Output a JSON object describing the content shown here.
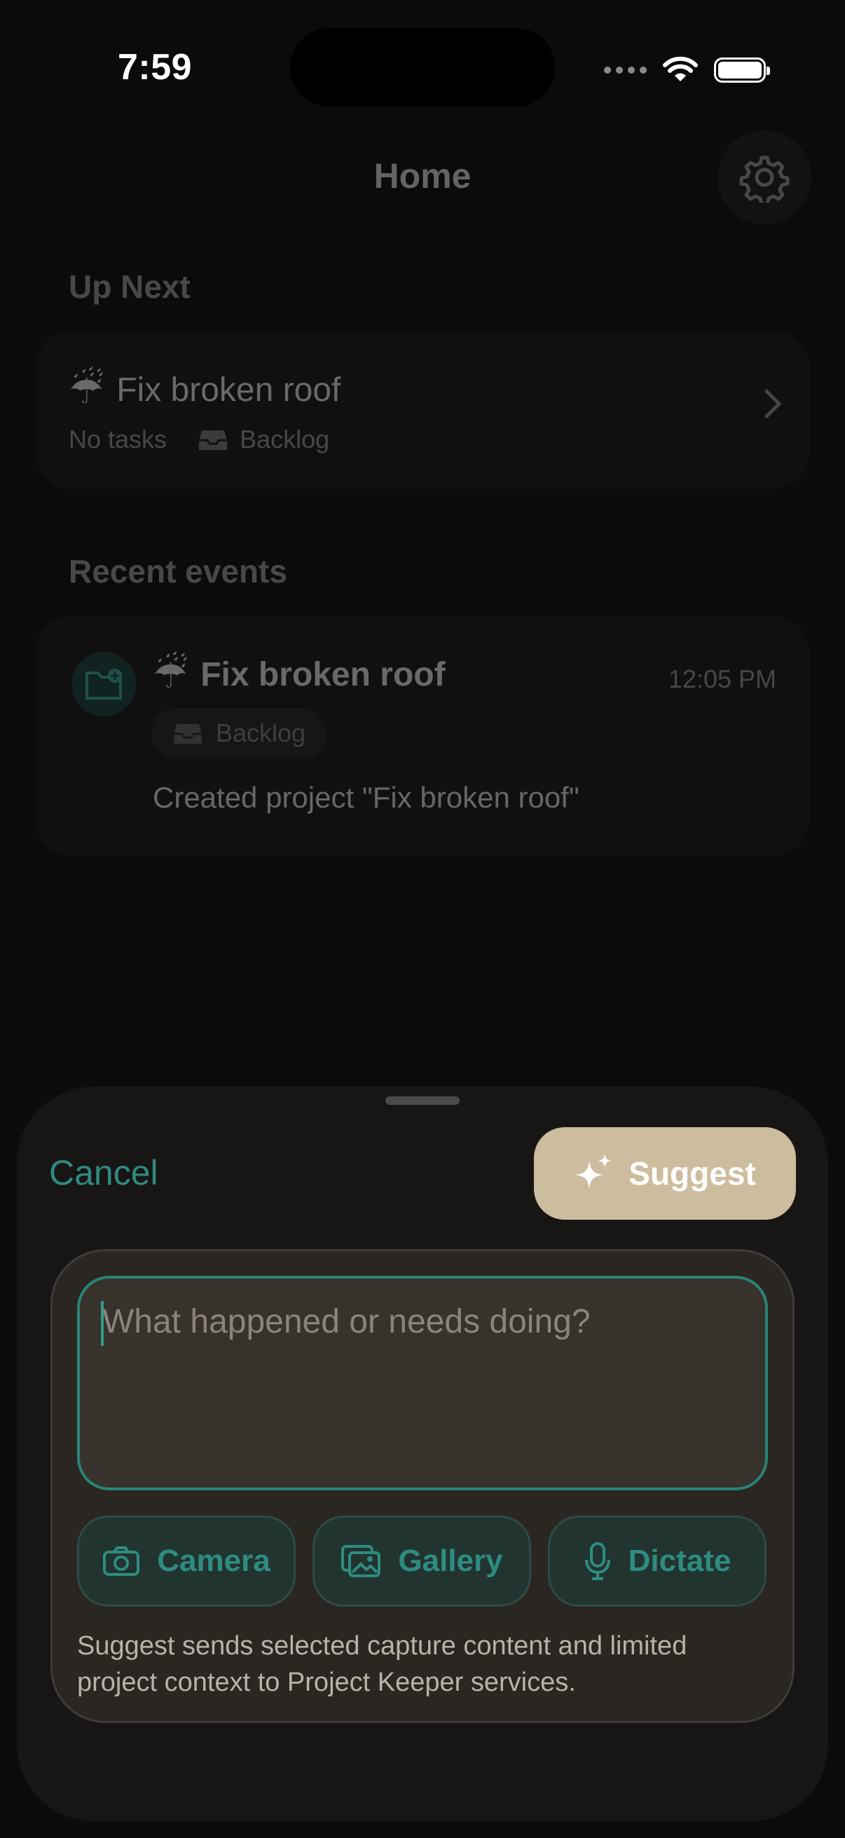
{
  "status_bar": {
    "time": "7:59"
  },
  "header": {
    "title": "Home"
  },
  "up_next": {
    "heading": "Up Next",
    "item": {
      "emoji": "☔",
      "title": "Fix broken roof",
      "tasks": "No tasks",
      "status": "Backlog"
    }
  },
  "recent_events": {
    "heading": "Recent events",
    "item": {
      "emoji": "☔",
      "title": "Fix broken roof",
      "time": "12:05 PM",
      "badge": "Backlog",
      "description": "Created project \"Fix broken roof\""
    }
  },
  "sheet": {
    "cancel_label": "Cancel",
    "suggest_label": "Suggest",
    "input": {
      "placeholder": "What happened or needs doing?",
      "value": ""
    },
    "tools": [
      {
        "label": "Camera",
        "icon": "camera-icon"
      },
      {
        "label": "Gallery",
        "icon": "gallery-icon"
      },
      {
        "label": "Dictate",
        "icon": "microphone-icon"
      }
    ],
    "disclaimer": "Suggest sends selected capture content and limited project context to Project Keeper services."
  },
  "colors": {
    "accent": "#2f8a80",
    "suggest_button": "#cdbd9f",
    "sheet_background": "#171614"
  }
}
